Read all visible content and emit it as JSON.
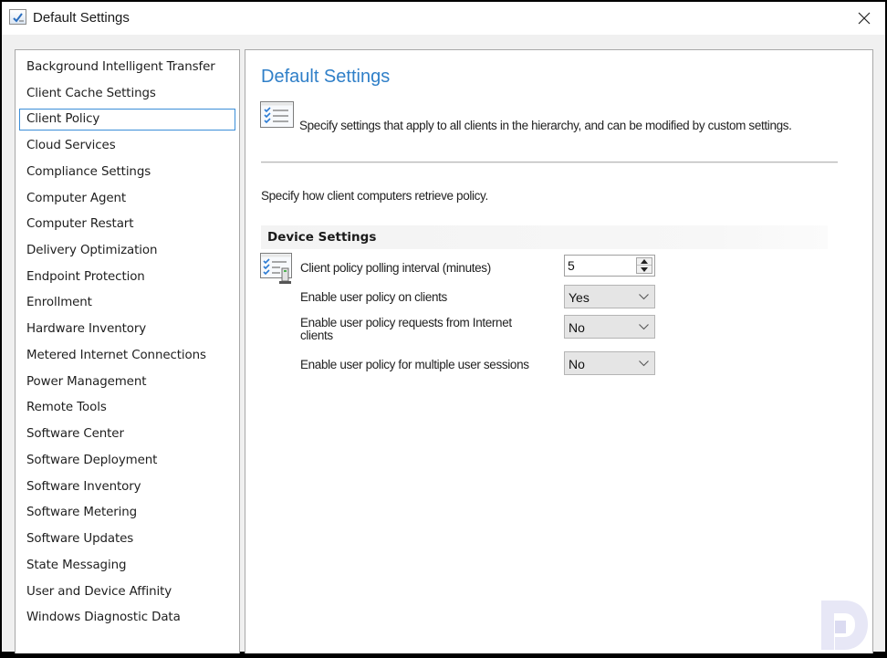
{
  "window": {
    "title": "Default Settings",
    "icon": "settings-check-icon",
    "close_icon": "close-icon"
  },
  "sidebar": {
    "selected": "Client Policy",
    "items": [
      {
        "label": "Background Intelligent Transfer"
      },
      {
        "label": "Client Cache Settings"
      },
      {
        "label": "Client Policy"
      },
      {
        "label": "Cloud Services"
      },
      {
        "label": "Compliance Settings"
      },
      {
        "label": "Computer Agent"
      },
      {
        "label": "Computer Restart"
      },
      {
        "label": "Delivery Optimization"
      },
      {
        "label": "Endpoint Protection"
      },
      {
        "label": "Enrollment"
      },
      {
        "label": "Hardware Inventory"
      },
      {
        "label": "Metered Internet Connections"
      },
      {
        "label": "Power Management"
      },
      {
        "label": "Remote Tools"
      },
      {
        "label": "Software Center"
      },
      {
        "label": "Software Deployment"
      },
      {
        "label": "Software Inventory"
      },
      {
        "label": "Software Metering"
      },
      {
        "label": "Software Updates"
      },
      {
        "label": "State Messaging"
      },
      {
        "label": "User and Device Affinity"
      },
      {
        "label": "Windows Diagnostic Data"
      }
    ]
  },
  "main": {
    "title": "Default Settings",
    "description": "Specify settings that apply to all clients in the hierarchy, and can be modified by custom settings.",
    "section_description": "Specify how client computers retrieve policy.",
    "group_title": "Device Settings",
    "settings": [
      {
        "label": "Client policy polling interval (minutes)",
        "type": "spinner",
        "value": "5"
      },
      {
        "label": "Enable user policy on clients",
        "type": "dropdown",
        "value": "Yes"
      },
      {
        "label": "Enable user policy requests from Internet clients",
        "type": "dropdown",
        "value": "No"
      },
      {
        "label": "Enable user policy for multiple user sessions",
        "type": "dropdown",
        "value": "No"
      }
    ]
  },
  "colors": {
    "accent_title": "#2f7fc8",
    "selection_border": "#3b8ed8"
  }
}
